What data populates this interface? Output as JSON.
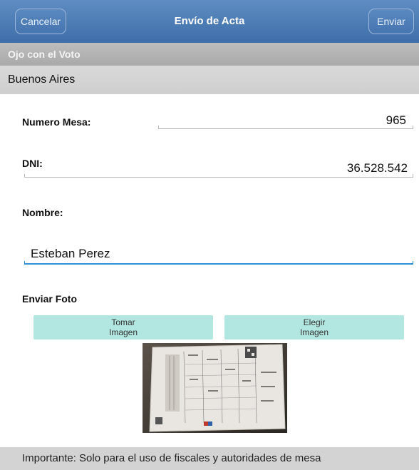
{
  "header": {
    "cancel_label": "Cancelar",
    "title": "Envío de Acta",
    "send_label": "Enviar"
  },
  "org_label": "Ojo con el Voto",
  "region": "Buenos Aires",
  "form": {
    "mesa_label": "Numero Mesa:",
    "mesa_value": "965",
    "dni_label": "DNI:",
    "dni_value": "36.528.542",
    "nombre_label": "Nombre:",
    "nombre_value": "Esteban Perez",
    "foto_label": "Enviar Foto",
    "take_photo": [
      "Tomar",
      "Imagen"
    ],
    "choose_photo": [
      "Elegir",
      "Imagen"
    ]
  },
  "footer_text": "Importante: Solo para el uso de fiscales y autoridades de mesa",
  "colors": {
    "header": "#4a79b4",
    "photo_button": "#b2e6e0",
    "focus_line": "#2d8fd4"
  }
}
